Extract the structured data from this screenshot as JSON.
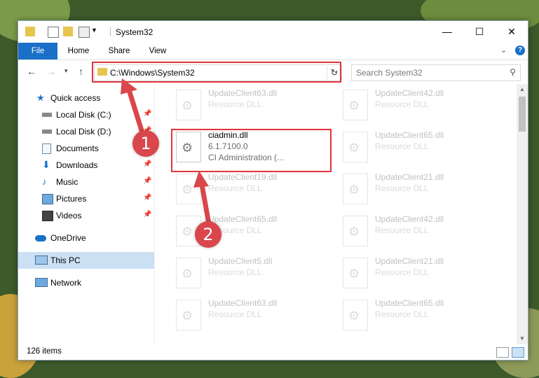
{
  "window": {
    "title": "System32"
  },
  "ribbon": {
    "tabs": [
      "File",
      "Home",
      "Share",
      "View"
    ]
  },
  "nav": {
    "address": "C:\\Windows\\System32",
    "search_placeholder": "Search System32"
  },
  "sidebar": {
    "items": [
      {
        "label": "Quick access",
        "icon": "star-icon",
        "pinned": false
      },
      {
        "label": "Local Disk (C:)",
        "icon": "drive-icon",
        "pinned": true
      },
      {
        "label": "Local Disk (D:)",
        "icon": "drive-icon",
        "pinned": true
      },
      {
        "label": "Documents",
        "icon": "documents-icon",
        "pinned": true
      },
      {
        "label": "Downloads",
        "icon": "download-icon",
        "pinned": true
      },
      {
        "label": "Music",
        "icon": "music-icon",
        "pinned": true
      },
      {
        "label": "Pictures",
        "icon": "pictures-icon",
        "pinned": true
      },
      {
        "label": "Videos",
        "icon": "videos-icon",
        "pinned": true
      },
      {
        "label": "OneDrive",
        "icon": "cloud-icon",
        "pinned": false
      },
      {
        "label": "This PC",
        "icon": "computer-icon",
        "pinned": false
      },
      {
        "label": "Network",
        "icon": "network-icon",
        "pinned": false
      }
    ]
  },
  "files": [
    {
      "name": "UpdateClient63.dll",
      "desc": "Resource DLL"
    },
    {
      "name": "UpdateClient42.dll",
      "desc": "Resource DLL"
    },
    {
      "name": "ciadmin.dll",
      "version": "6.1.7100.0",
      "desc": "CI Administration (..."
    },
    {
      "name": "UpdateClient65.dll",
      "desc": "Resource DLL"
    },
    {
      "name": "UpdateClient19.dll",
      "desc": "Resource DLL"
    },
    {
      "name": "UpdateClient21.dll",
      "desc": "Resource DLL"
    },
    {
      "name": "UpdateClient65.dll",
      "desc": "Resource DLL"
    },
    {
      "name": "UpdateClient42.dll",
      "desc": "Resource DLL"
    },
    {
      "name": "UpdateClient5.dll",
      "desc": "Resource DLL"
    },
    {
      "name": "UpdateClient21.dll",
      "desc": "Resource DLL"
    },
    {
      "name": "UpdateClient63.dll",
      "desc": "Resource DLL"
    },
    {
      "name": "UpdateClient65.dll",
      "desc": "Resource DLL"
    }
  ],
  "status": {
    "count": "126 items"
  },
  "annotations": {
    "step1": "1",
    "step2": "2"
  },
  "colors": {
    "accent": "#1a6fc9",
    "highlight": "#e0353b",
    "badge": "#d9464b"
  }
}
